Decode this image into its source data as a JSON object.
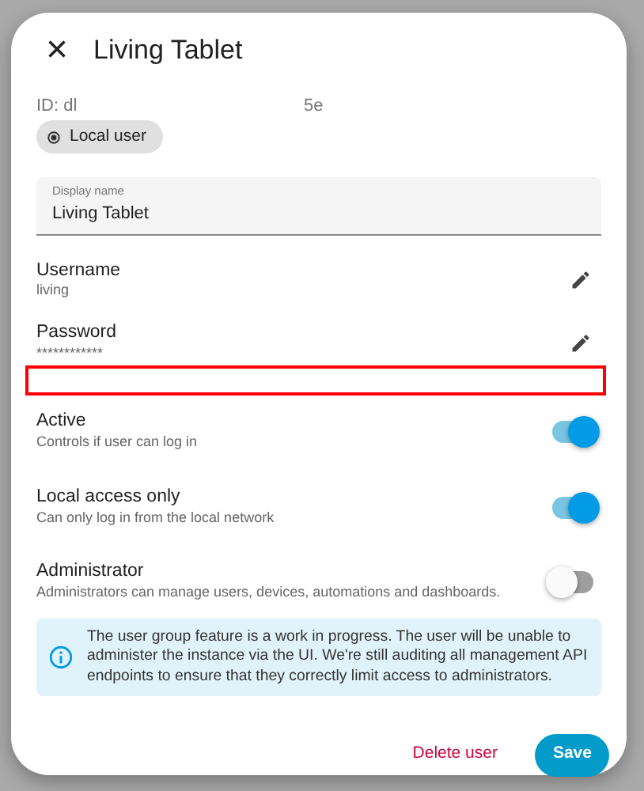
{
  "dialog": {
    "title": "Living Tablet",
    "close_icon": "×"
  },
  "id_parts": [
    "ID: dl",
    "5e"
  ],
  "chip": {
    "label": "Local user"
  },
  "display_name": {
    "label": "Display name",
    "value": "Living Tablet"
  },
  "fields": [
    {
      "label": "Username",
      "value": "living"
    },
    {
      "label": "Password",
      "value": "************"
    }
  ],
  "annotation": {
    "kind": "box"
  },
  "toggles": [
    {
      "label": "Active",
      "description": "Controls if user can log in",
      "on": true
    },
    {
      "label": "Local access only",
      "description": "Can only log in from the local network",
      "on": true
    },
    {
      "label": "Administrator",
      "description": "Administrators can manage users, devices, automations and dashboards.",
      "on": false
    }
  ],
  "alert": {
    "text": "The user group feature is a work in progress. The user will be unable to administer the instance via the UI. We're still auditing all management API endpoints to ensure that they correctly limit access to administrators."
  },
  "buttons": [
    {
      "label": "Delete user",
      "kind": "danger"
    },
    {
      "label": "Save",
      "kind": "primary"
    }
  ]
}
